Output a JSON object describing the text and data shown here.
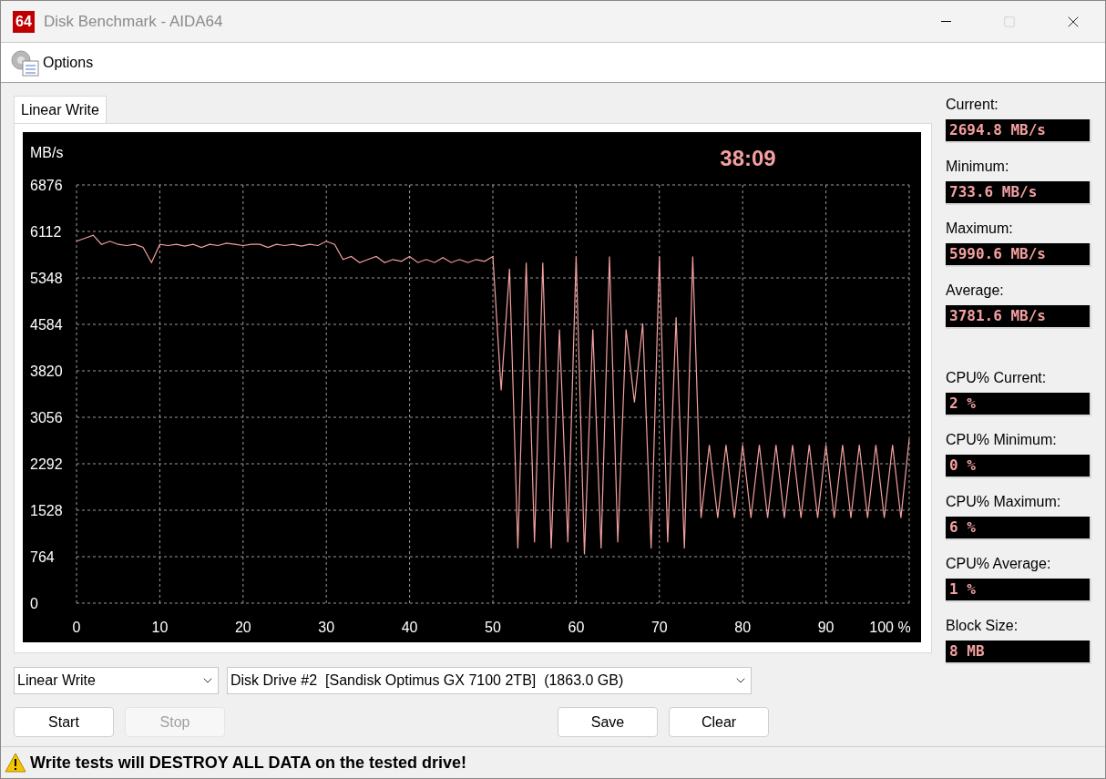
{
  "window": {
    "title": "Disk Benchmark - AIDA64",
    "logo": "64"
  },
  "menu": [
    {
      "label": "Options"
    }
  ],
  "tabs": [
    {
      "label": "Linear Write",
      "selected": true
    }
  ],
  "graph": {
    "elapsed_time": "38:09",
    "chart_data": {
      "type": "line",
      "grid": true,
      "ylabel": "MB/s",
      "xlim": [
        0,
        100
      ],
      "ylim": [
        0,
        6876
      ],
      "xticks": [
        0,
        10,
        20,
        30,
        40,
        50,
        60,
        70,
        80,
        90,
        {
          "value": 100,
          "label": "100 %"
        }
      ],
      "yticks": [
        0,
        764,
        1528,
        2292,
        3056,
        3820,
        4584,
        5348,
        6112,
        6876
      ],
      "x": [
        0,
        1,
        2,
        3,
        4,
        5,
        6,
        7,
        8,
        9,
        10,
        11,
        12,
        13,
        14,
        15,
        16,
        17,
        18,
        19,
        20,
        21,
        22,
        23,
        24,
        25,
        26,
        27,
        28,
        29,
        30,
        31,
        32,
        33,
        34,
        35,
        36,
        37,
        38,
        39,
        40,
        41,
        42,
        43,
        44,
        45,
        46,
        47,
        48,
        49,
        50,
        51,
        52,
        53,
        54,
        55,
        56,
        57,
        58,
        59,
        60,
        61,
        62,
        63,
        64,
        65,
        66,
        67,
        68,
        69,
        70,
        71,
        72,
        73,
        74,
        75,
        76,
        77,
        78,
        79,
        80,
        81,
        82,
        83,
        84,
        85,
        86,
        87,
        88,
        89,
        90,
        91,
        92,
        93,
        94,
        95,
        96,
        97,
        98,
        99,
        100
      ],
      "series": [
        {
          "color": "#f4a0a0",
          "values": [
            5950,
            6000,
            6050,
            5900,
            5950,
            5900,
            5880,
            5900,
            5850,
            5600,
            5900,
            5880,
            5900,
            5870,
            5900,
            5850,
            5900,
            5880,
            5920,
            5900,
            5880,
            5900,
            5900,
            5850,
            5900,
            5880,
            5900,
            5870,
            5900,
            5880,
            5950,
            5900,
            5650,
            5700,
            5600,
            5650,
            5700,
            5600,
            5650,
            5620,
            5700,
            5600,
            5650,
            5600,
            5680,
            5600,
            5650,
            5600,
            5650,
            5620,
            5700,
            3500,
            5500,
            900,
            5600,
            1000,
            5600,
            900,
            4500,
            1000,
            5700,
            800,
            4500,
            900,
            5700,
            1000,
            4500,
            3300,
            4600,
            900,
            5700,
            1000,
            4700,
            900,
            5700,
            1400,
            2600,
            1400,
            2600,
            1400,
            2600,
            1400,
            2600,
            1400,
            2600,
            1400,
            2600,
            1400,
            2600,
            1400,
            2600,
            1400,
            2600,
            1400,
            2600,
            1400,
            2600,
            1400,
            2600,
            1400,
            2700
          ]
        }
      ]
    }
  },
  "test_select": {
    "value": "Linear Write"
  },
  "drive_select": {
    "value": "Disk Drive #2  [Sandisk Optimus GX 7100 2TB]  (1863.0 GB)"
  },
  "buttons_left": [
    {
      "label": "Start",
      "disabled": false
    },
    {
      "label": "Stop",
      "disabled": true
    }
  ],
  "buttons_right": [
    {
      "label": "Save",
      "disabled": false
    },
    {
      "label": "Clear",
      "disabled": false
    }
  ],
  "stats": [
    {
      "label": "Current:",
      "value": "2694.8 MB/s"
    },
    {
      "label": "Minimum:",
      "value": "733.6 MB/s"
    },
    {
      "label": "Maximum:",
      "value": "5990.6 MB/s"
    },
    {
      "label": "Average:",
      "value": "3781.6 MB/s"
    }
  ],
  "cpu_stats": [
    {
      "label": "CPU% Current:",
      "value": "2 %"
    },
    {
      "label": "CPU% Minimum:",
      "value": "0 %"
    },
    {
      "label": "CPU% Maximum:",
      "value": "6 %"
    },
    {
      "label": "CPU% Average:",
      "value": "1 %"
    },
    {
      "label": "Block Size:",
      "value": "8 MB"
    }
  ],
  "status_bar": {
    "warning": "Write tests will DESTROY ALL DATA on the tested drive!"
  }
}
